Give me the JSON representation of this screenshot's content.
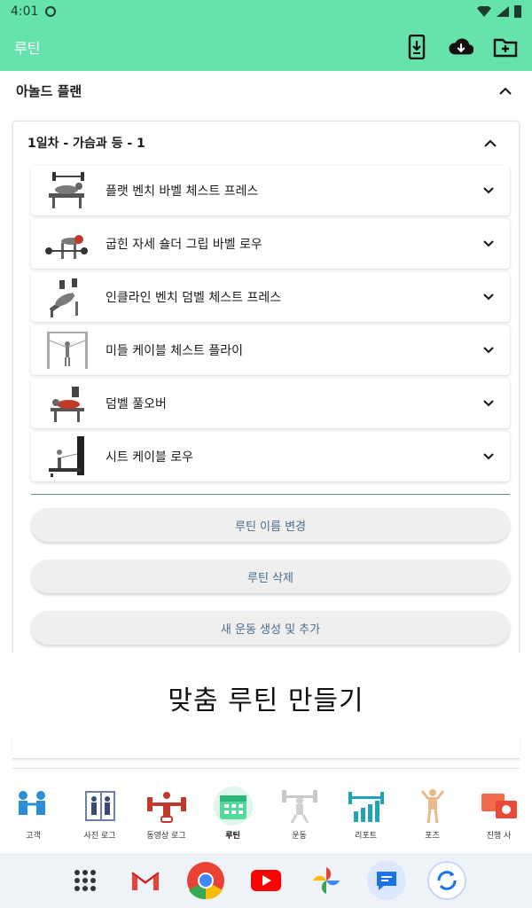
{
  "status_bar": {
    "time": "4:01"
  },
  "app_bar": {
    "title": "루틴",
    "actions": [
      "phone-download-icon",
      "cloud-download-icon",
      "folder-add-icon"
    ]
  },
  "plan": {
    "title": "아놀드 플랜",
    "expanded": true,
    "day": {
      "title": "1일차 - 가슴과 등 - 1",
      "exercises": [
        {
          "label": "플랫 벤치 바벨 체스트 프레스"
        },
        {
          "label": "굽힌 자세 숄더 그립 바벨 로우"
        },
        {
          "label": "인클라인 벤치 덤벨 체스트 프레스"
        },
        {
          "label": "미들 케이블 체스트 플라이"
        },
        {
          "label": "덤벨 풀오버"
        },
        {
          "label": "시트 케이블 로우"
        }
      ]
    },
    "buttons": {
      "rename": "루틴 이름 변경",
      "delete": "루틴 삭제",
      "add_exercise": "새 운동 생성 및 추가"
    }
  },
  "banner": {
    "text": "맞춤 루틴 만들기"
  },
  "bottom_nav": {
    "items": [
      {
        "label": "고객",
        "icon": "clients-icon"
      },
      {
        "label": "사진 로그",
        "icon": "photo-log-icon"
      },
      {
        "label": "동영상 로그",
        "icon": "video-log-icon"
      },
      {
        "label": "루틴",
        "icon": "routine-calendar-icon",
        "active": true
      },
      {
        "label": "운동",
        "icon": "exercise-icon"
      },
      {
        "label": "리포트",
        "icon": "report-icon"
      },
      {
        "label": "포즈",
        "icon": "pose-icon"
      },
      {
        "label": "진행 사",
        "icon": "progress-photo-icon"
      }
    ]
  },
  "dock": {
    "apps": [
      "app-drawer-icon",
      "gmail-icon",
      "chrome-icon",
      "youtube-icon",
      "photos-icon",
      "messages-icon",
      "sync-app-icon"
    ]
  },
  "colors": {
    "accent": "#66e3ad",
    "button_text": "#4a6d8c",
    "divider": "#5f8f86"
  }
}
